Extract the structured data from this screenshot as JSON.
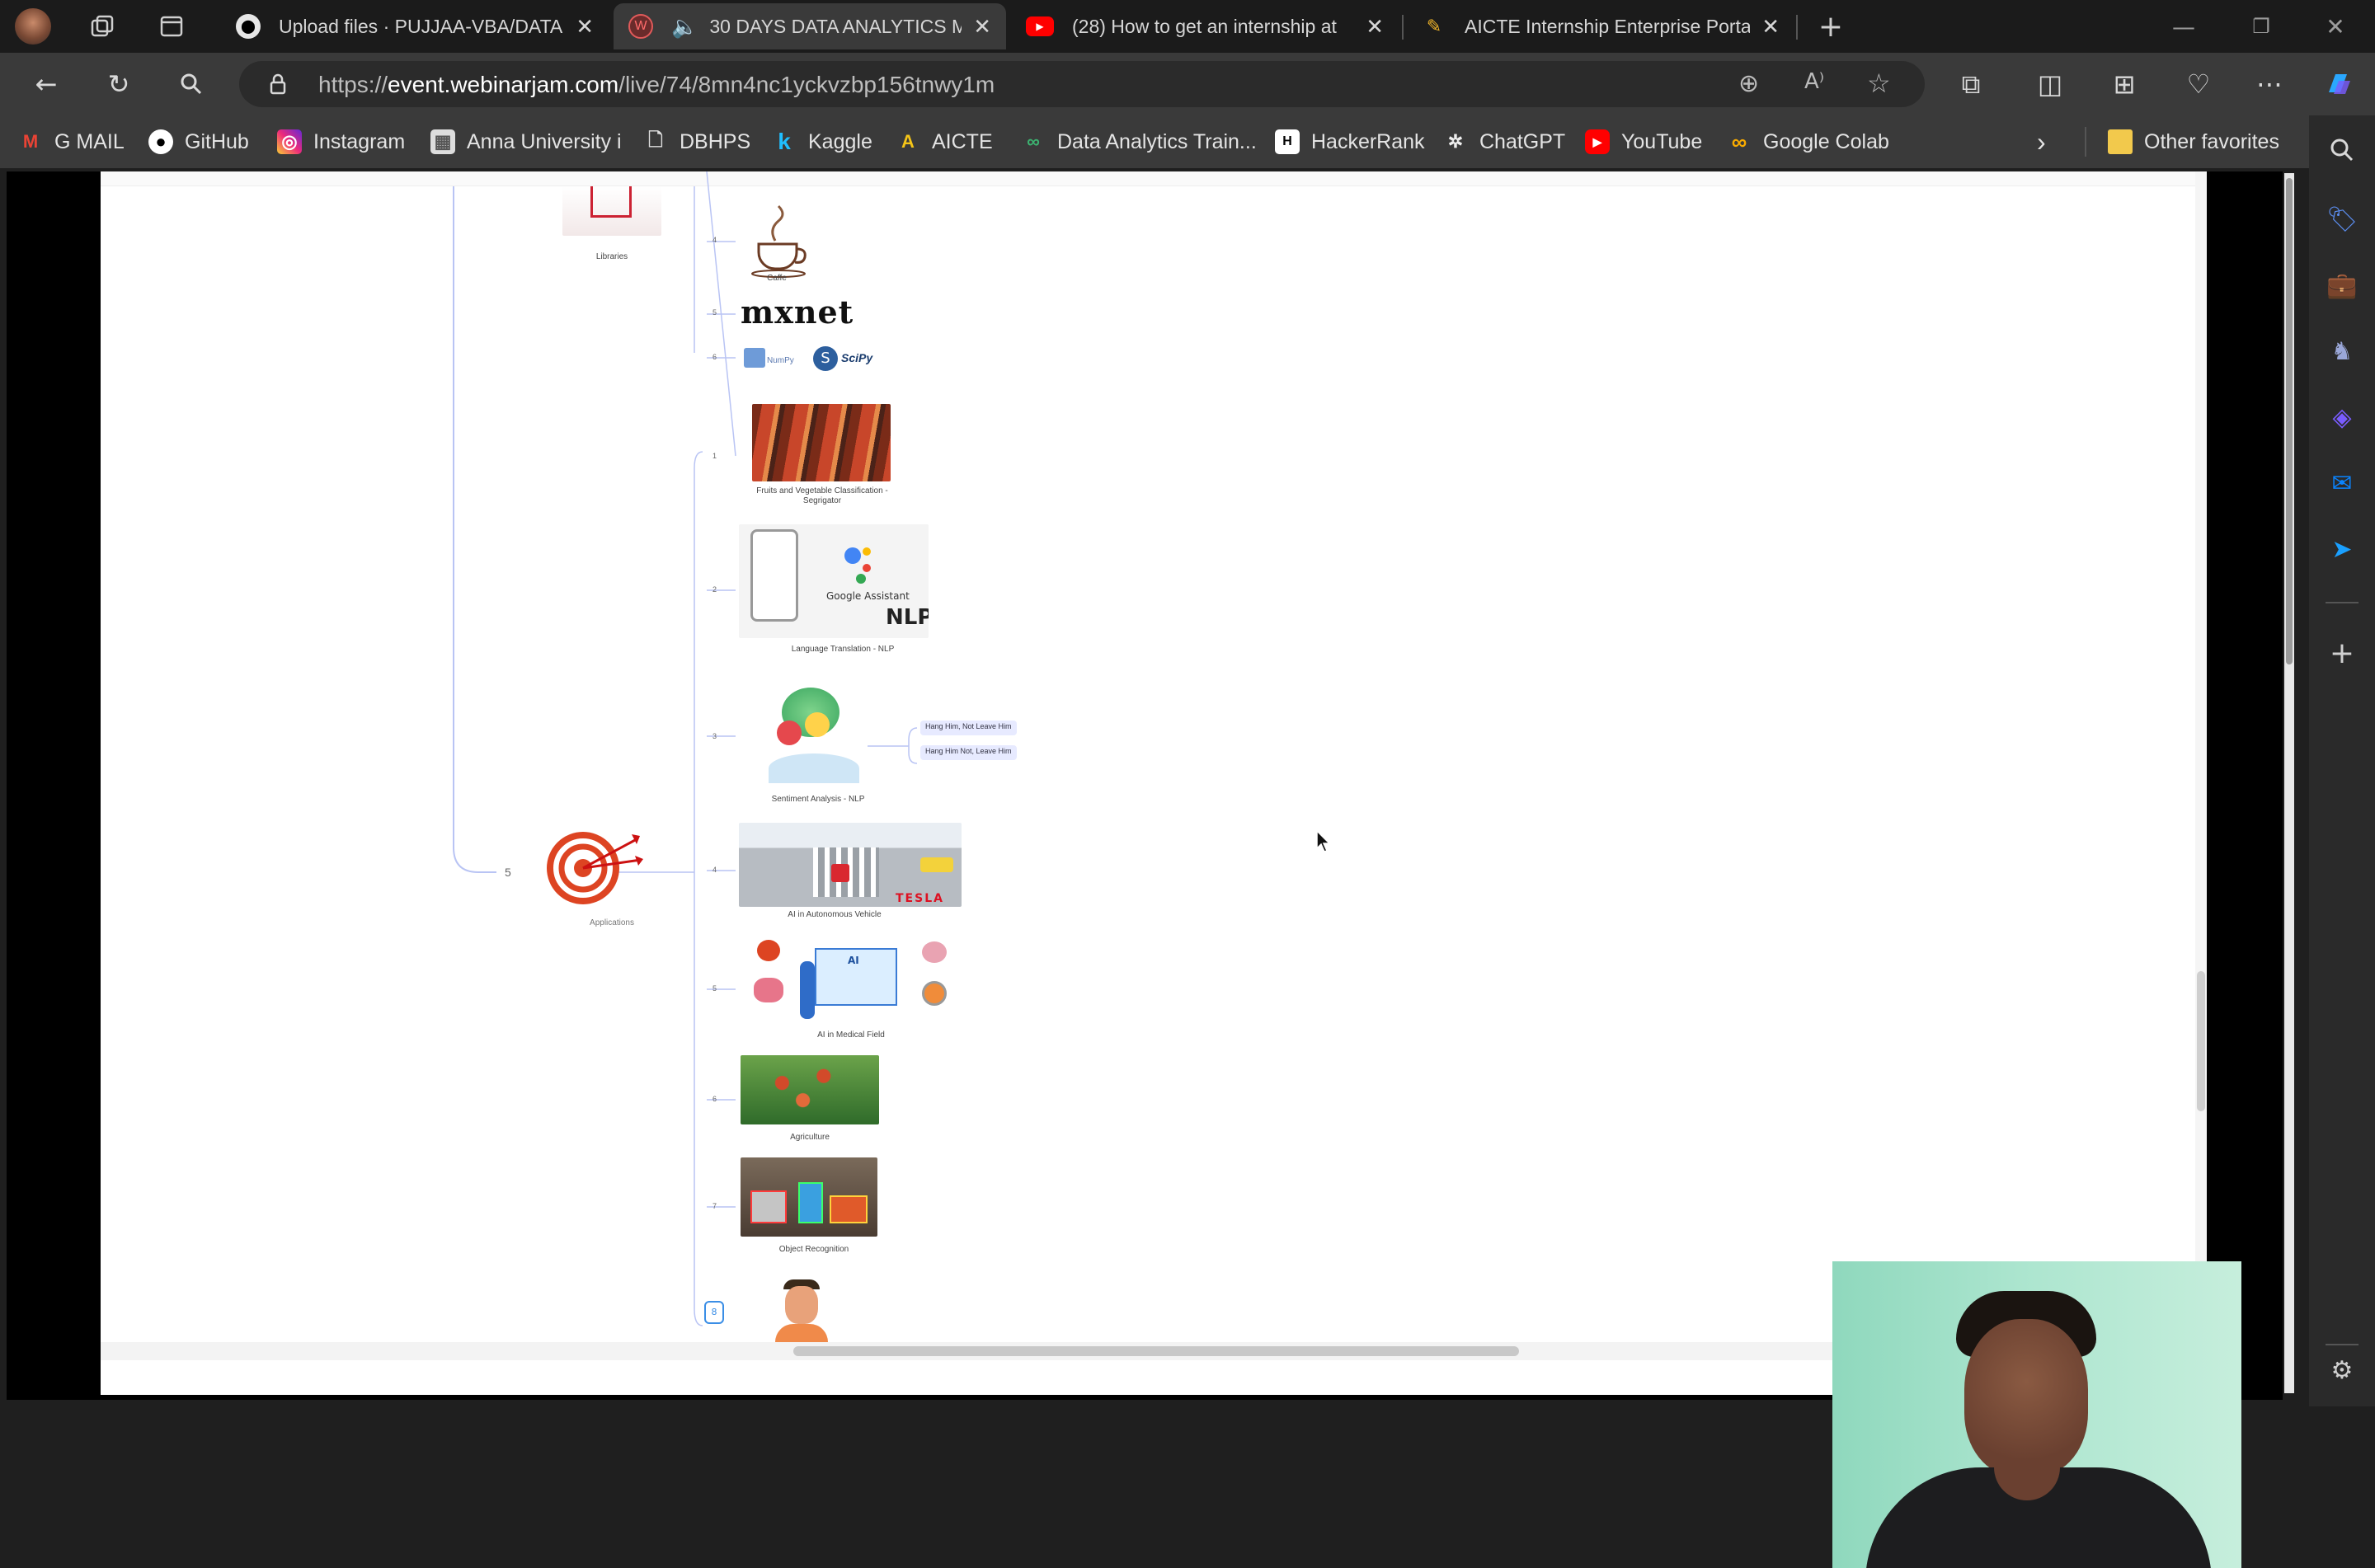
{
  "tabs": [
    {
      "title": "Upload files · PUJJAA-VBA/DATA",
      "icon": "github-icon"
    },
    {
      "title": "30 DAYS DATA ANALYTICS M",
      "icon": "webinarjam-icon",
      "active": true
    },
    {
      "title": "(28) How to get an internship at",
      "icon": "youtube-icon"
    },
    {
      "title": "AICTE Internship Enterprise Porta",
      "icon": "aicte-icon"
    }
  ],
  "address": {
    "prefix": "https://",
    "domain": "event.webinarjam.com",
    "path": "/live/74/8mn4nc1yckvzbp156tnwy1m"
  },
  "bookmarks": [
    {
      "label": "G MAIL",
      "icon": "gmail-icon"
    },
    {
      "label": "GitHub",
      "icon": "github-icon"
    },
    {
      "label": "Instagram",
      "icon": "instagram-icon"
    },
    {
      "label": "Anna University i",
      "icon": "anna-university-icon"
    },
    {
      "label": "DBHPS",
      "icon": "document-icon"
    },
    {
      "label": "Kaggle",
      "icon": "kaggle-icon"
    },
    {
      "label": "AICTE",
      "icon": "aicte-icon"
    },
    {
      "label": "Data Analytics Train...",
      "icon": "data-analytics-icon"
    },
    {
      "label": "HackerRank",
      "icon": "hackerrank-icon"
    },
    {
      "label": "ChatGPT",
      "icon": "chatgpt-icon"
    },
    {
      "label": "YouTube",
      "icon": "youtube-icon"
    },
    {
      "label": "Google Colab",
      "icon": "colab-icon"
    }
  ],
  "other_favorites": "Other favorites",
  "mindmap": {
    "libraries_label": "Libraries",
    "library_items": [
      {
        "num": "4",
        "label": "Caffe"
      },
      {
        "num": "5",
        "label": "mxnet"
      },
      {
        "num": "6",
        "label_a": "NumPy",
        "label_b": "SciPy"
      }
    ],
    "applications_num": "5",
    "applications_label": "Applications",
    "app_items": [
      {
        "num": "1",
        "label": "Fruits and Vegetable Classification -",
        "label2": "Segrigator"
      },
      {
        "num": "2",
        "label": "Language Translation - NLP",
        "overlay1": "Google Assistant",
        "overlay2": "NLP"
      },
      {
        "num": "3",
        "label": "Sentiment Analysis -  NLP"
      },
      {
        "num": "4",
        "label": "AI in Autonomous Vehicle",
        "overlay1": "TESLA"
      },
      {
        "num": "5",
        "label": "AI in Medical Field",
        "overlay1": "AI"
      },
      {
        "num": "6",
        "label": "Agriculture"
      },
      {
        "num": "7",
        "label": "Object Recognition"
      },
      {
        "num": "8",
        "label": ""
      }
    ],
    "sentiment_chips": [
      "Hang Him, Not Leave Him",
      "Hang Him Not, Leave Him"
    ]
  },
  "colors": {
    "tabbar": "#1b1b1b",
    "toolbar": "#3a3a3a",
    "edge_accent": "#0a84ff",
    "mindmap_line": "#b9c4f4"
  }
}
